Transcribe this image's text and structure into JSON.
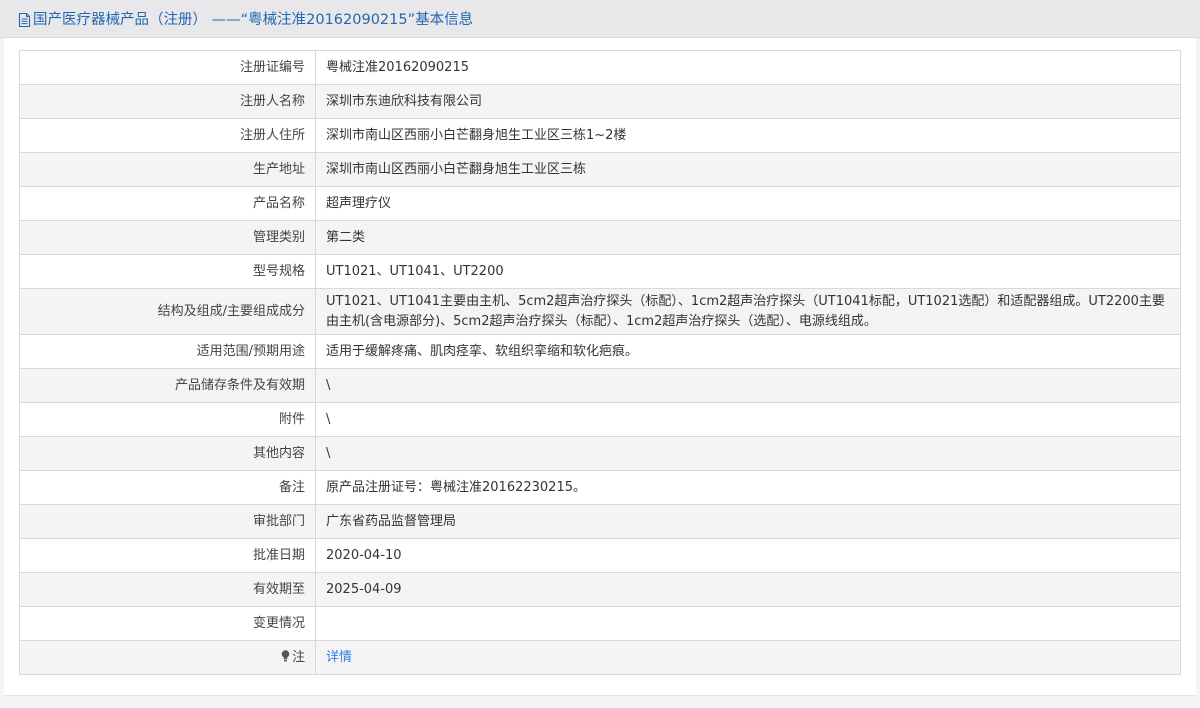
{
  "header": {
    "title": "国产医疗器械产品（注册） ——“粤械注准20162090215”基本信息"
  },
  "rows": [
    {
      "label": "注册证编号",
      "value": "粤械注准20162090215"
    },
    {
      "label": "注册人名称",
      "value": "深圳市东迪欣科技有限公司"
    },
    {
      "label": "注册人住所",
      "value": "深圳市南山区西丽小白芒翻身旭生工业区三栋1~2楼"
    },
    {
      "label": "生产地址",
      "value": "深圳市南山区西丽小白芒翻身旭生工业区三栋"
    },
    {
      "label": "产品名称",
      "value": "超声理疗仪"
    },
    {
      "label": "管理类别",
      "value": "第二类"
    },
    {
      "label": "型号规格",
      "value": "UT1021、UT1041、UT2200"
    },
    {
      "label": "结构及组成/主要组成成分",
      "value": "UT1021、UT1041主要由主机、5cm2超声治疗探头（标配）、1cm2超声治疗探头（UT1041标配，UT1021选配）和适配器组成。UT2200主要由主机(含电源部分)、5cm2超声治疗探头（标配）、1cm2超声治疗探头（选配）、电源线组成。"
    },
    {
      "label": "适用范围/预期用途",
      "value": "适用于缓解疼痛、肌肉痉挛、软组织挛缩和软化疤痕。"
    },
    {
      "label": "产品储存条件及有效期",
      "value": "\\"
    },
    {
      "label": "附件",
      "value": "\\"
    },
    {
      "label": "其他内容",
      "value": "\\"
    },
    {
      "label": "备注",
      "value": "原产品注册证号：粤械注准20162230215。"
    },
    {
      "label": "审批部门",
      "value": "广东省药品监督管理局"
    },
    {
      "label": "批准日期",
      "value": "2020-04-10"
    },
    {
      "label": "有效期至",
      "value": "2025-04-09"
    },
    {
      "label": "变更情况",
      "value": ""
    }
  ],
  "note_row": {
    "label": "注",
    "icon": "lightbulb-icon",
    "link_text": "详情"
  },
  "colors": {
    "title": "#2267b3",
    "link": "#2a7ee8",
    "header_bg": "#e8e8ea",
    "row_alt_bg": "#f4f4f4",
    "border": "#d9d9d9"
  }
}
